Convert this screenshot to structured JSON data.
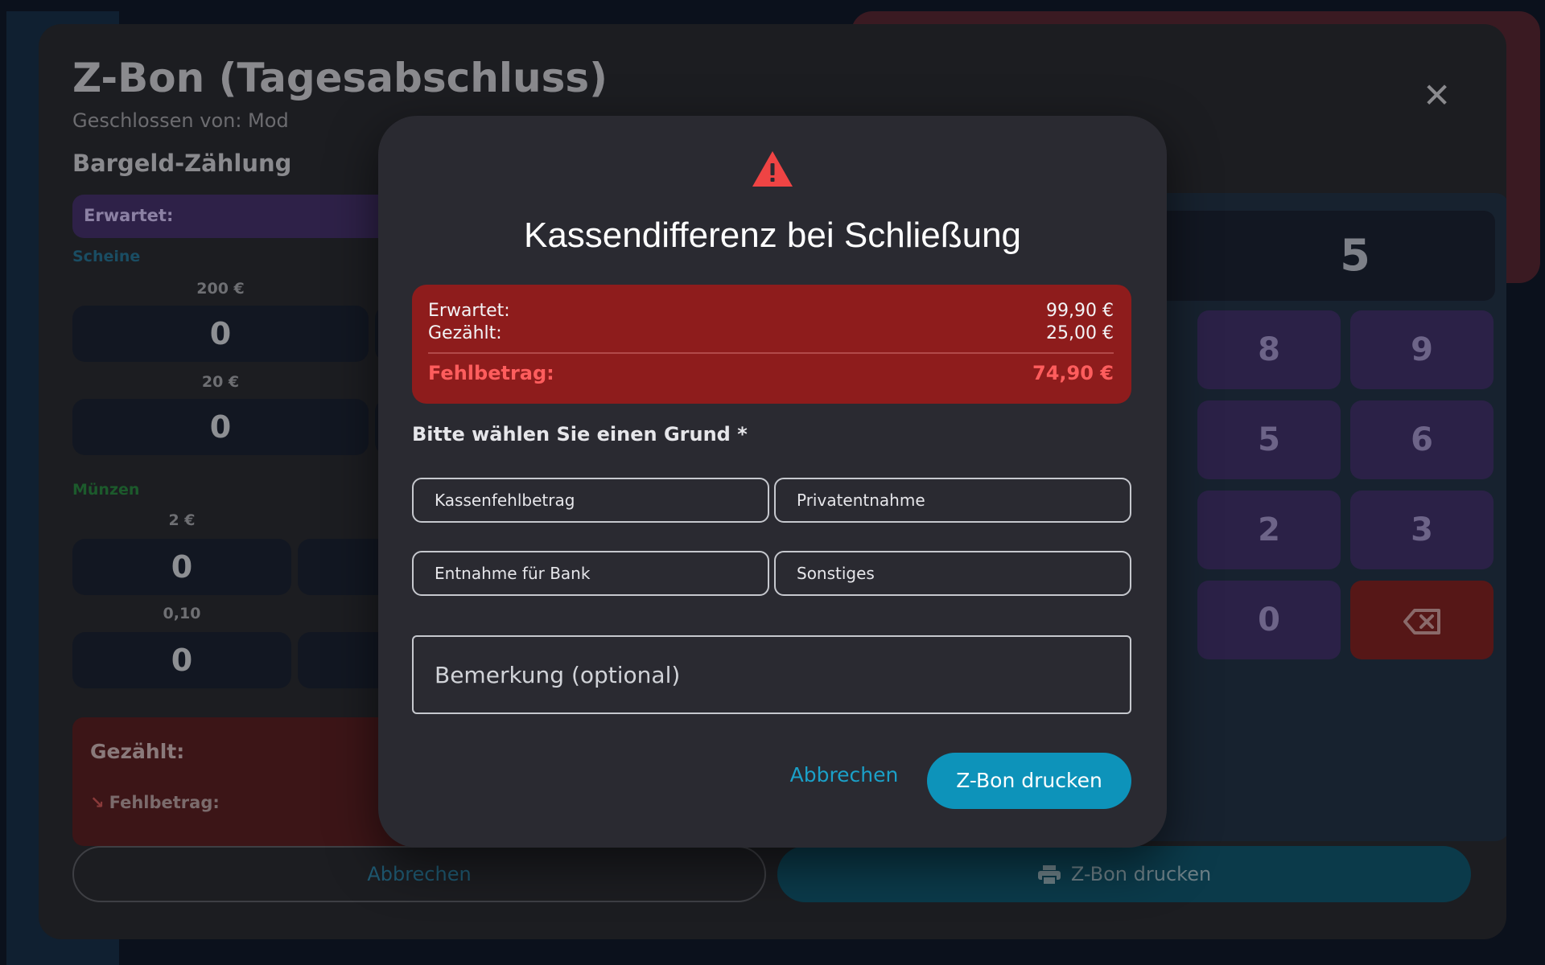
{
  "sheet": {
    "title": "Z-Bon (Tagesabschluss)",
    "closed_by": "Geschlossen von: Mod",
    "section": "Bargeld-Zählung",
    "expected_label": "Erwartet:",
    "notes_label": "Scheine",
    "coins_label": "Münzen",
    "denominations": {
      "d200": "200 €",
      "d20": "20 €",
      "d2": "2 €",
      "d010": "0,10"
    },
    "count_value": "0",
    "counted_label": "Gezählt:",
    "shortfall_label": "Fehlbetrag:",
    "keypad_display": "5",
    "keys": [
      "8",
      "9",
      "5",
      "6",
      "2",
      "3",
      "0"
    ],
    "footer": {
      "cancel": "Abbrechen",
      "print": "Z-Bon drucken"
    },
    "colors": {
      "notes_label": "#1a4d63",
      "coins_label": "#1c5a2c"
    }
  },
  "modal": {
    "icon": "warning-icon",
    "title": "Kassendifferenz bei Schließung",
    "summary": {
      "expected_label": "Erwartet:",
      "expected_value": "99,90 €",
      "counted_label": "Gezählt:",
      "counted_value": "25,00 €",
      "shortfall_label": "Fehlbetrag:",
      "shortfall_value": "74,90 €"
    },
    "reason_prompt": "Bitte wählen Sie einen Grund *",
    "reasons": [
      "Kassenfehlbetrag",
      "Privatentnahme",
      "Entnahme für Bank",
      "Sonstiges"
    ],
    "note_placeholder": "Bemerkung (optional)",
    "cancel_label": "Abbrechen",
    "print_label": "Z-Bon drucken",
    "colors": {
      "accent": "#0d93ba",
      "danger": "#8e1c1c",
      "warning": "#ef4444"
    }
  }
}
